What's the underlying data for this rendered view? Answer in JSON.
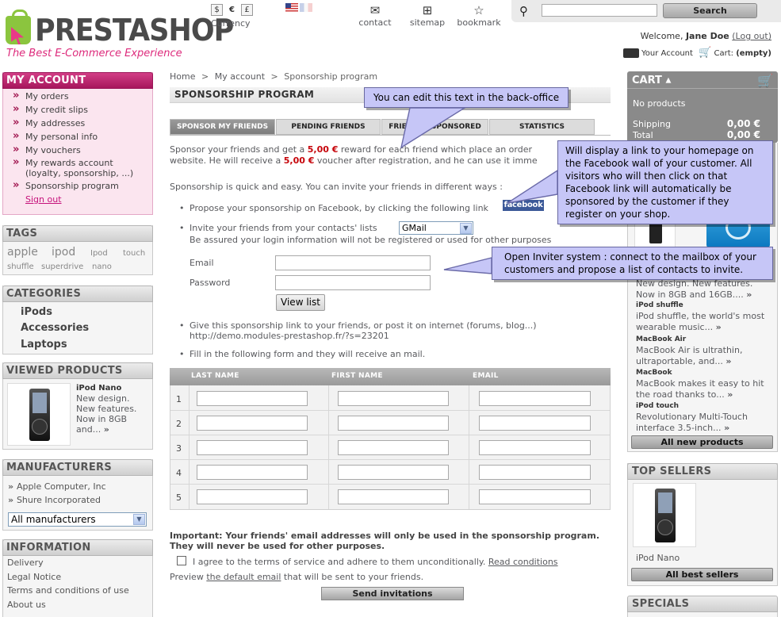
{
  "header": {
    "logo": "PRESTASHOP",
    "tagline": "The Best E-Commerce Experience",
    "currency": {
      "symbols": [
        "$",
        "€",
        "£"
      ],
      "label": "Currency"
    },
    "links": [
      {
        "label": "contact",
        "icon": "envelope-icon"
      },
      {
        "label": "sitemap",
        "icon": "sitemap-icon"
      },
      {
        "label": "bookmark",
        "icon": "star-icon"
      }
    ],
    "search": {
      "button": "Search",
      "value": ""
    },
    "welcome_prefix": "Welcome,",
    "user_name": "Jane Doe",
    "logout": "(Log out)",
    "your_account": "Your Account",
    "cart_label": "Cart:",
    "cart_status": "(empty)"
  },
  "left": {
    "my_account": {
      "title": "MY ACCOUNT",
      "items": [
        "My orders",
        "My credit slips",
        "My addresses",
        "My personal info",
        "My vouchers",
        "My rewards account (loyalty, sponsorship, ...)",
        "Sponsorship program"
      ],
      "signout": "Sign out"
    },
    "tags": {
      "title": "TAGS",
      "items": [
        "apple",
        "ipod",
        "Ipod",
        "touch",
        "shuffle",
        "superdrive",
        "nano"
      ]
    },
    "categories": {
      "title": "CATEGORIES",
      "items": [
        "iPods",
        "Accessories",
        "Laptops"
      ]
    },
    "viewed": {
      "title": "VIEWED PRODUCTS",
      "product_name": "iPod Nano",
      "product_desc": "New design. New features. Now in 8GB and..."
    },
    "manufacturers": {
      "title": "MANUFACTURERS",
      "items": [
        "Apple Computer, Inc",
        "Shure Incorporated"
      ],
      "select": "All manufacturers"
    },
    "information": {
      "title": "INFORMATION",
      "items": [
        "Delivery",
        "Legal Notice",
        "Terms and conditions of use",
        "About us"
      ]
    }
  },
  "center": {
    "breadcrumb": [
      "Home",
      ">",
      "My account",
      ">",
      "Sponsorship program"
    ],
    "title": "SPONSORSHIP PROGRAM",
    "tabs": [
      "SPONSOR MY FRIENDS",
      "PENDING FRIENDS",
      "FRIENDS I SPONSORED",
      "STATISTICS"
    ],
    "intro_1": "Sponsor your friends and get a",
    "reward": "5,00 €",
    "intro_2": "reward for each friend which place an order",
    "intro_3": "website. He will receive a",
    "voucher": "5,00 €",
    "intro_4": "voucher after registration, and he can use it imme",
    "ways": "Sponsorship is quick and easy. You can invite your friends in different ways :",
    "facebook_text": "Propose your sponsorship on Facebook, by clicking the following link",
    "facebook_button": "facebook",
    "contacts_text": "Invite your friends from your contacts' lists",
    "provider": "GMail",
    "assured": "Be assured your login information will not be registered or used for other purposes",
    "email_label": "Email",
    "password_label": "Password",
    "view_list": "View list",
    "link_text": "Give this sponsorship link to your friends, or post it on internet (forums, blog...)",
    "link_url": "http://demo.modules-prestashop.fr/?s=23201",
    "fill_text": "Fill in the following form and they will receive an mail.",
    "table": {
      "headers": [
        "LAST NAME",
        "FIRST NAME",
        "EMAIL"
      ],
      "rows": [
        "1",
        "2",
        "3",
        "4",
        "5"
      ]
    },
    "important": "Important: Your friends' email addresses will only be used in the sponsorship program. They will never be used for other purposes.",
    "agree_text": "I agree to the terms of service and adhere to them unconditionally.",
    "read_conditions": "Read conditions",
    "preview_1": "Preview",
    "preview_link": "the default email",
    "preview_2": "that will be sent to your friends.",
    "send": "Send invitations"
  },
  "callouts": {
    "backoffice": "You can edit this text in the back-office",
    "facebook": "Will display a link to your homepage on the Facebook wall of your customer. All visitors who will then click on that Facebook link will automatically be sponsored by the customer if they register on your shop.",
    "inviter": "Open Inviter system : connect to the mailbox of your customers and propose a list of contacts to invite."
  },
  "right": {
    "cart": {
      "title": "CART",
      "no_products": "No products",
      "shipping_label": "Shipping",
      "shipping": "0,00 €",
      "total_label": "Total",
      "total": "0,00 €"
    },
    "new_products": {
      "partial_desc": [
        "New design. New features.",
        "Now in 8GB and 16GB...."
      ],
      "items": [
        {
          "name": "iPod shuffle",
          "desc": "iPod shuffle, the world's most wearable music..."
        },
        {
          "name": "MacBook Air",
          "desc": "MacBook Air is ultrathin, ultraportable, and..."
        },
        {
          "name": "MacBook",
          "desc": "MacBook makes it easy to hit the road thanks to..."
        },
        {
          "name": "iPod touch",
          "desc": "Revolutionary Multi-Touch interface 3.5-inch..."
        }
      ],
      "all_button": "All new products"
    },
    "top_sellers": {
      "title": "TOP SELLERS",
      "product": "iPod Nano",
      "all_button": "All best sellers"
    },
    "specials": {
      "title": "SPECIALS"
    }
  }
}
